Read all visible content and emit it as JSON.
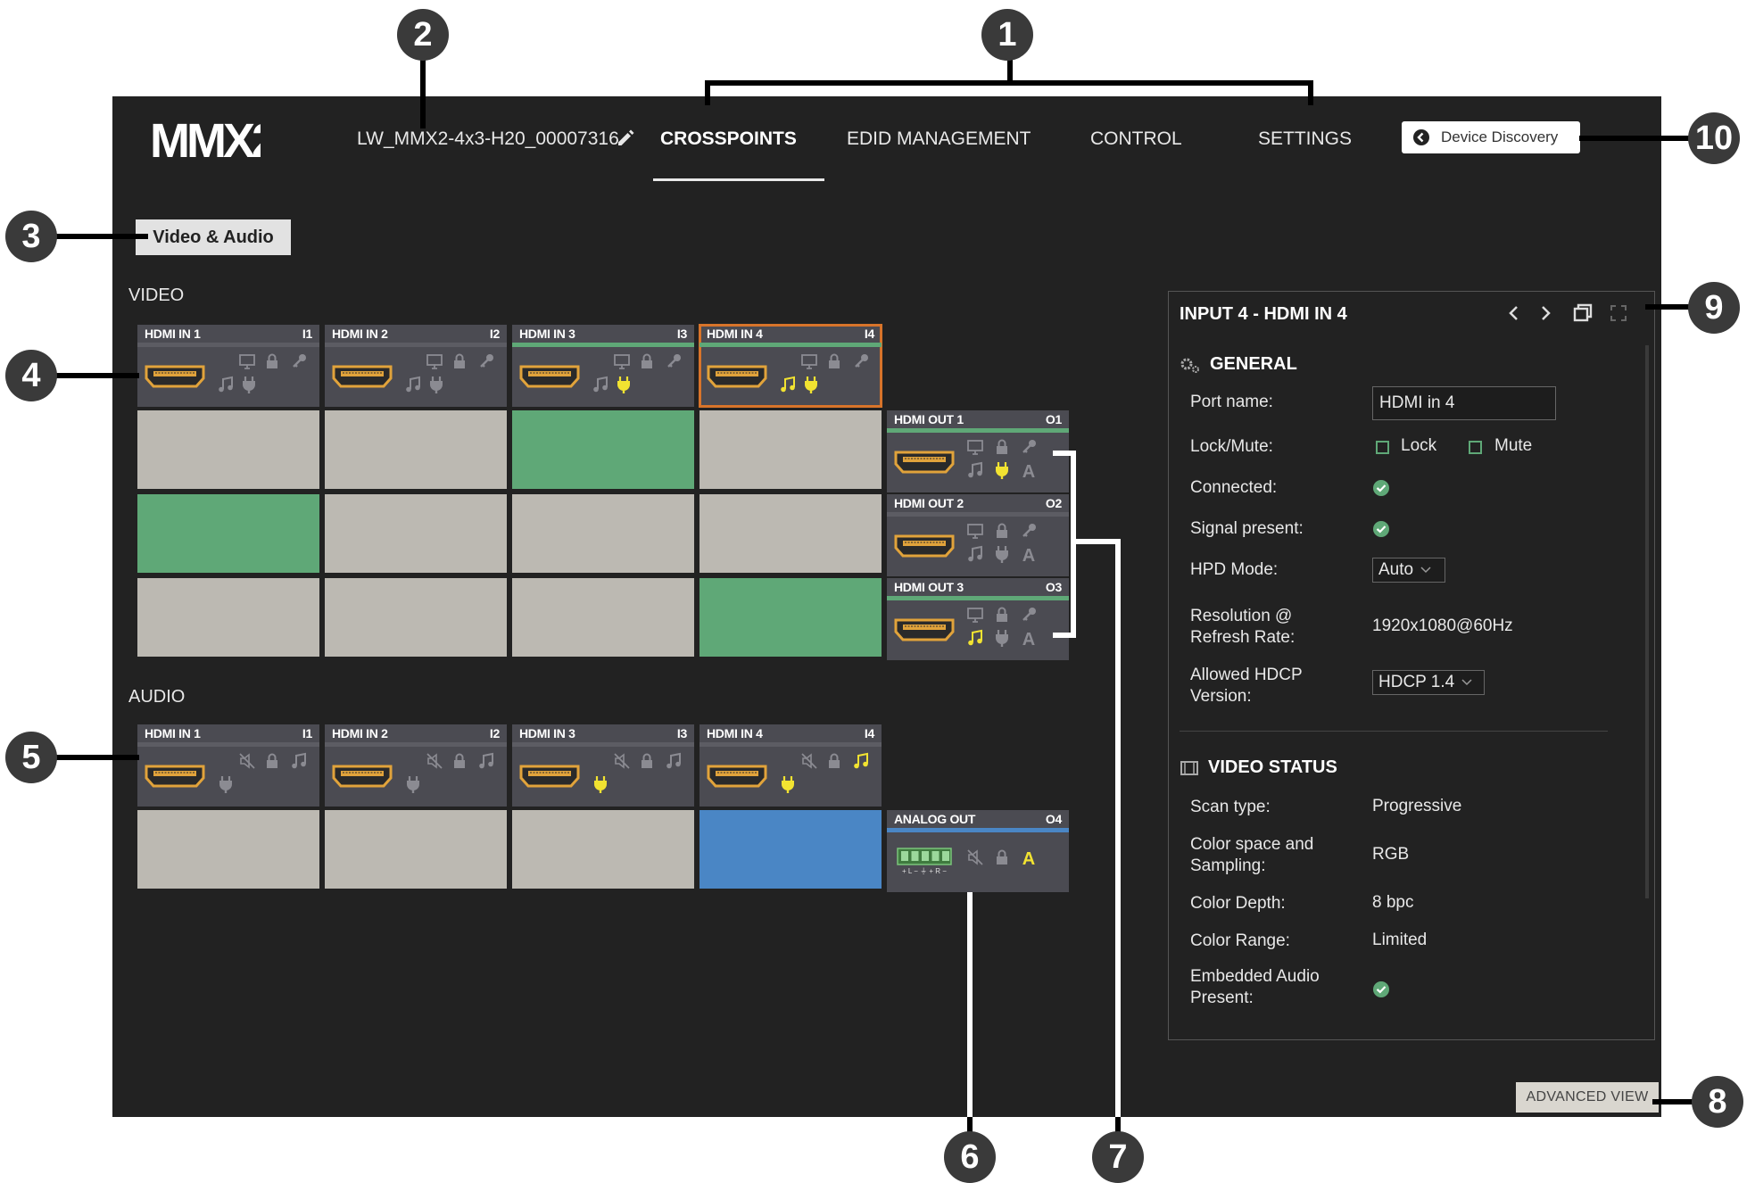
{
  "header": {
    "logo_text": "MMX2",
    "device_name": "LW_MMX2-4x3-H20_00007316",
    "tabs": [
      {
        "label": "CROSSPOINTS",
        "active": true
      },
      {
        "label": "EDID MANAGEMENT",
        "active": false
      },
      {
        "label": "CONTROL",
        "active": false
      },
      {
        "label": "SETTINGS",
        "active": false
      }
    ],
    "device_discovery_label": "Device Discovery"
  },
  "mode_button": "Video & Audio",
  "video": {
    "section_label": "VIDEO",
    "inputs": [
      {
        "name": "HDMI IN 1",
        "id": "I1",
        "signal": false,
        "connected": false,
        "audio": false,
        "selected": false
      },
      {
        "name": "HDMI IN 2",
        "id": "I2",
        "signal": false,
        "connected": false,
        "audio": false,
        "selected": false
      },
      {
        "name": "HDMI IN 3",
        "id": "I3",
        "signal": true,
        "connected": true,
        "audio": false,
        "selected": false
      },
      {
        "name": "HDMI IN 4",
        "id": "I4",
        "signal": true,
        "connected": true,
        "audio": true,
        "selected": true
      }
    ],
    "outputs": [
      {
        "name": "HDMI OUT 1",
        "id": "O1",
        "signal": true,
        "connected": true,
        "audio": false
      },
      {
        "name": "HDMI OUT 2",
        "id": "O2",
        "signal": false,
        "connected": false,
        "audio": false
      },
      {
        "name": "HDMI OUT 3",
        "id": "O3",
        "signal": true,
        "connected": false,
        "audio": true
      }
    ],
    "crosspoints": [
      [
        false,
        false,
        true,
        false
      ],
      [
        true,
        false,
        false,
        false
      ],
      [
        false,
        false,
        false,
        true
      ]
    ]
  },
  "audio": {
    "section_label": "AUDIO",
    "inputs": [
      {
        "name": "HDMI IN 1",
        "id": "I1",
        "connected": false,
        "audio": false
      },
      {
        "name": "HDMI IN 2",
        "id": "I2",
        "connected": false,
        "audio": false
      },
      {
        "name": "HDMI IN 3",
        "id": "I3",
        "connected": true,
        "audio": false
      },
      {
        "name": "HDMI IN 4",
        "id": "I4",
        "connected": true,
        "audio": true
      }
    ],
    "output": {
      "name": "ANALOG OUT",
      "id": "O4"
    },
    "crosspoints": [
      false,
      false,
      false,
      true
    ]
  },
  "panel": {
    "title": "INPUT 4 - HDMI IN 4",
    "general": {
      "title": "GENERAL",
      "port_name_label": "Port name:",
      "port_name_value": "HDMI in 4",
      "lock_mute_label": "Lock/Mute:",
      "lock_label": "Lock",
      "mute_label": "Mute",
      "connected_label": "Connected:",
      "signal_label": "Signal present:",
      "hpd_label": "HPD Mode:",
      "hpd_value": "Auto",
      "resolution_label_1": "Resolution @",
      "resolution_label_2": "Refresh Rate:",
      "resolution_value": "1920x1080@60Hz",
      "hdcp_label_1": "Allowed HDCP",
      "hdcp_label_2": "Version:",
      "hdcp_value": "HDCP 1.4"
    },
    "video_status": {
      "title": "VIDEO STATUS",
      "scan_label": "Scan type:",
      "scan_value": "Progressive",
      "colorspace_label_1": "Color space and",
      "colorspace_label_2": "Sampling:",
      "colorspace_value": "RGB",
      "depth_label": "Color Depth:",
      "depth_value": "8 bpc",
      "range_label": "Color Range:",
      "range_value": "Limited",
      "audio_label_1": "Embedded Audio",
      "audio_label_2": "Present:"
    }
  },
  "advanced_view_label": "ADVANCED VIEW",
  "callouts": [
    "1",
    "2",
    "3",
    "4",
    "5",
    "6",
    "7",
    "8",
    "9",
    "10"
  ],
  "colors": {
    "background": "#222222",
    "crosspoint_on_video": "#5fa877",
    "crosspoint_on_audio": "#4a86c5",
    "crosspoint_off": "#bcb9b2",
    "active_icon": "#f2e331",
    "connector": "#e1a33b",
    "selected_outline": "#d8742a"
  }
}
